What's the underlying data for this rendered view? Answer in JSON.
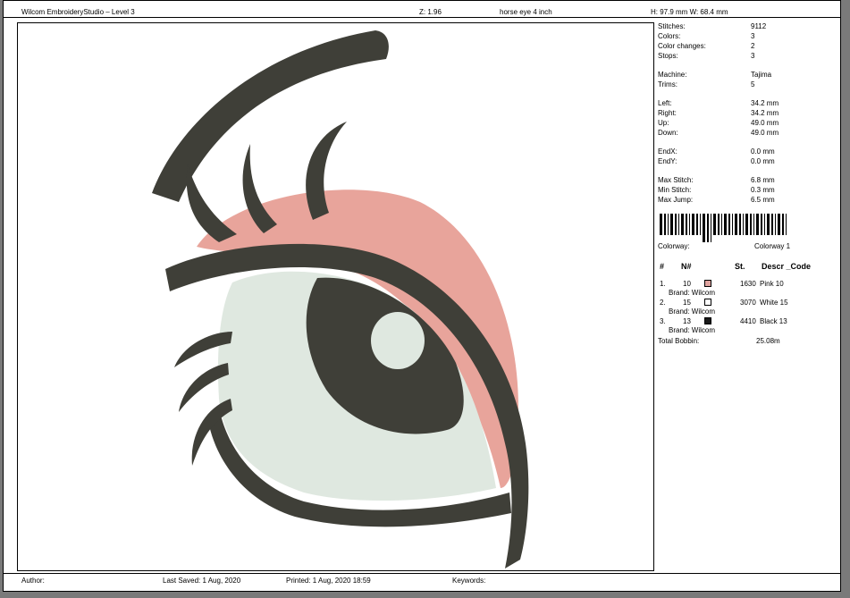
{
  "header": {
    "app_title": "Wilcom EmbroideryStudio – Level 3",
    "zoom": "Z: 1.96",
    "design_name": "horse eye 4 inch",
    "dimensions": "H: 97.9 mm   W: 68.4 mm"
  },
  "stats": [
    {
      "label": "Stitches:",
      "value": "9112"
    },
    {
      "label": "Colors:",
      "value": "3"
    },
    {
      "label": "Color changes:",
      "value": "2"
    },
    {
      "label": "Stops:",
      "value": "3"
    },
    {
      "label": "Machine:",
      "value": "Tajima"
    },
    {
      "label": "Trims:",
      "value": "5"
    },
    {
      "label": "Left:",
      "value": "34.2 mm"
    },
    {
      "label": "Right:",
      "value": "34.2 mm"
    },
    {
      "label": "Up:",
      "value": "49.0 mm"
    },
    {
      "label": "Down:",
      "value": "49.0 mm"
    },
    {
      "label": "EndX:",
      "value": "0.0 mm"
    },
    {
      "label": "EndY:",
      "value": "0.0 mm"
    },
    {
      "label": "Max Stitch:",
      "value": "6.8 mm"
    },
    {
      "label": "Min Stitch:",
      "value": "0.3 mm"
    },
    {
      "label": "Max Jump:",
      "value": "6.5 mm"
    }
  ],
  "colorway": {
    "label": "Colorway:",
    "value": "Colorway 1"
  },
  "color_table": {
    "headers": {
      "index": "#",
      "number": "N#",
      "stitches": "St.",
      "descr": "Descr _Code"
    },
    "rows": [
      {
        "index": "1.",
        "number": "10",
        "swatch": "#e0a4a0",
        "stitches": "1630",
        "descr": "Pink 10",
        "brand": "Brand: Wilcom"
      },
      {
        "index": "2.",
        "number": "15",
        "swatch": "#ffffff",
        "stitches": "3070",
        "descr": "White 15",
        "brand": "Brand: Wilcom"
      },
      {
        "index": "3.",
        "number": "13",
        "swatch": "#1a1a1a",
        "stitches": "4410",
        "descr": "Black 13",
        "brand": "Brand: Wilcom"
      }
    ],
    "total_bobbin": {
      "label": "Total Bobbin:",
      "value": "25.08m"
    }
  },
  "footer": {
    "author": "Author:",
    "last_saved": "Last Saved:  1 Aug, 2020",
    "printed": "Printed:  1 Aug, 2020 18:59",
    "keywords": "Keywords:"
  },
  "design_colors": {
    "pink": "#e8a49b",
    "white": "#dfe8e0",
    "black": "#3f3f38"
  }
}
